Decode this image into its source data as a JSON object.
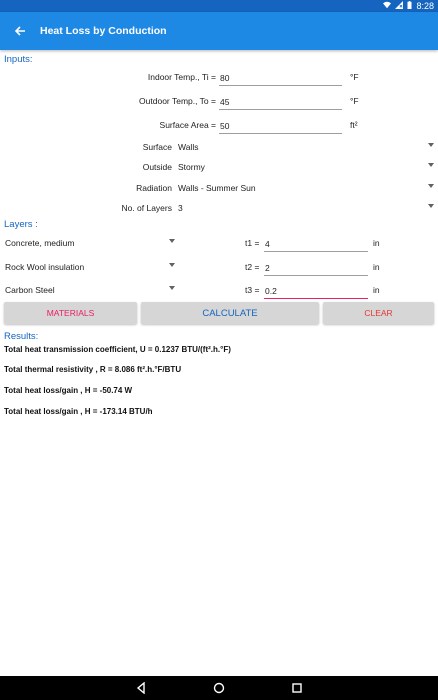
{
  "status": {
    "time": "8:28"
  },
  "appbar": {
    "title": "Heat Loss by Conduction"
  },
  "inputs": {
    "section_label": "Inputs:",
    "indoor": {
      "label": "Indoor Temp., Ti =",
      "value": "80",
      "unit": "°F"
    },
    "outdoor": {
      "label": "Outdoor Temp., To =",
      "value": "45",
      "unit": "°F"
    },
    "area": {
      "label": "Surface Area =",
      "value": "50",
      "unit": "ft²"
    },
    "surface": {
      "label": "Surface",
      "value": "Walls"
    },
    "outside": {
      "label": "Outside",
      "value": "Stormy"
    },
    "radiation": {
      "label": "Radiation",
      "value": "Walls - Summer Sun"
    },
    "layers_count": {
      "label": "No. of Layers",
      "value": "3"
    }
  },
  "layers": {
    "section_label": "Layers :",
    "items": [
      {
        "material": "Concrete, medium",
        "t_label": "t1 =",
        "t_value": "4",
        "unit": "in"
      },
      {
        "material": "Rock Wool insulation",
        "t_label": "t2 =",
        "t_value": "2",
        "unit": "in"
      },
      {
        "material": "Carbon Steel",
        "t_label": "t3 =",
        "t_value": "0.2",
        "unit": "in"
      }
    ]
  },
  "buttons": {
    "materials": "MATERIALS",
    "calculate": "CALCULATE",
    "clear": "CLEAR"
  },
  "results": {
    "section_label": "Results:",
    "lines": [
      "Total heat transmission coefficient, U = 0.1237 BTU/(ft².h.°F)",
      "Total thermal resistivity , R = 8.086 ft².h.°F/BTU",
      "Total heat loss/gain , H = -50.74 W",
      "Total heat loss/gain , H = -173.14 BTU/h"
    ]
  },
  "colors": {
    "primary": "#1e88e5",
    "primary_dark": "#1565c0",
    "accent": "#e91e63",
    "materials_text": "#e91e63",
    "calculate_text": "#1565c0",
    "clear_text": "#e53935"
  },
  "icons": [
    "wifi-icon",
    "signal-icon",
    "battery-icon",
    "back-arrow-icon",
    "nav-back-icon",
    "nav-home-icon",
    "nav-recents-icon"
  ]
}
